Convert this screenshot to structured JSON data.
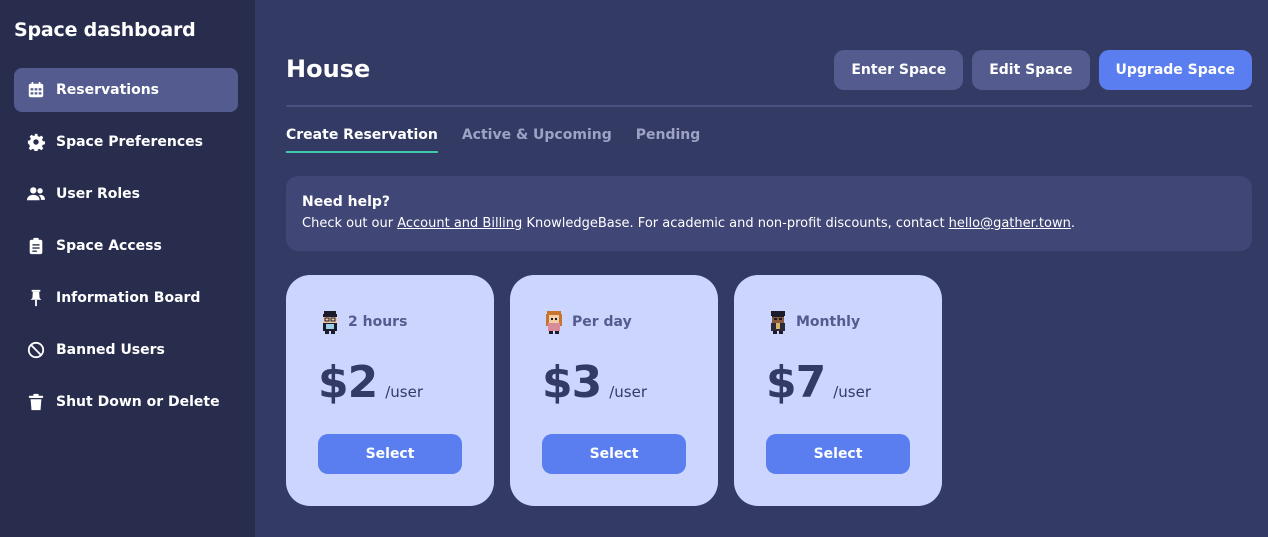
{
  "sidebar": {
    "title": "Space dashboard",
    "items": [
      {
        "label": "Reservations",
        "icon": "calendar-icon",
        "active": true
      },
      {
        "label": "Space Preferences",
        "icon": "gear-icon"
      },
      {
        "label": "User Roles",
        "icon": "users-icon"
      },
      {
        "label": "Space Access",
        "icon": "clipboard-icon"
      },
      {
        "label": "Information Board",
        "icon": "pin-icon"
      },
      {
        "label": "Banned Users",
        "icon": "ban-icon"
      },
      {
        "label": "Shut Down or Delete",
        "icon": "trash-icon"
      }
    ]
  },
  "header": {
    "title": "House",
    "buttons": {
      "enter": "Enter Space",
      "edit": "Edit Space",
      "upgrade": "Upgrade Space"
    }
  },
  "tabs": [
    "Create Reservation",
    "Active & Upcoming",
    "Pending"
  ],
  "help": {
    "title": "Need help?",
    "text_before": "Check out our ",
    "link1": "Account and Billing",
    "text_middle": " KnowledgeBase. For academic and non-profit discounts, contact ",
    "link2": "hello@gather.town",
    "text_after": "."
  },
  "plans": [
    {
      "label": "2 hours",
      "price": "$2",
      "unit": "/user",
      "button": "Select",
      "avatar": "avatar-icon"
    },
    {
      "label": "Per day",
      "price": "$3",
      "unit": "/user",
      "button": "Select",
      "avatar": "avatar-icon"
    },
    {
      "label": "Monthly",
      "price": "$7",
      "unit": "/user",
      "button": "Select",
      "avatar": "avatar-icon"
    }
  ],
  "colors": {
    "background": "#333a64",
    "sidebar": "#282d4e",
    "accent": "#5a7ef0",
    "card": "#cbd5fd",
    "tab_underline": "#3ec9a8"
  }
}
